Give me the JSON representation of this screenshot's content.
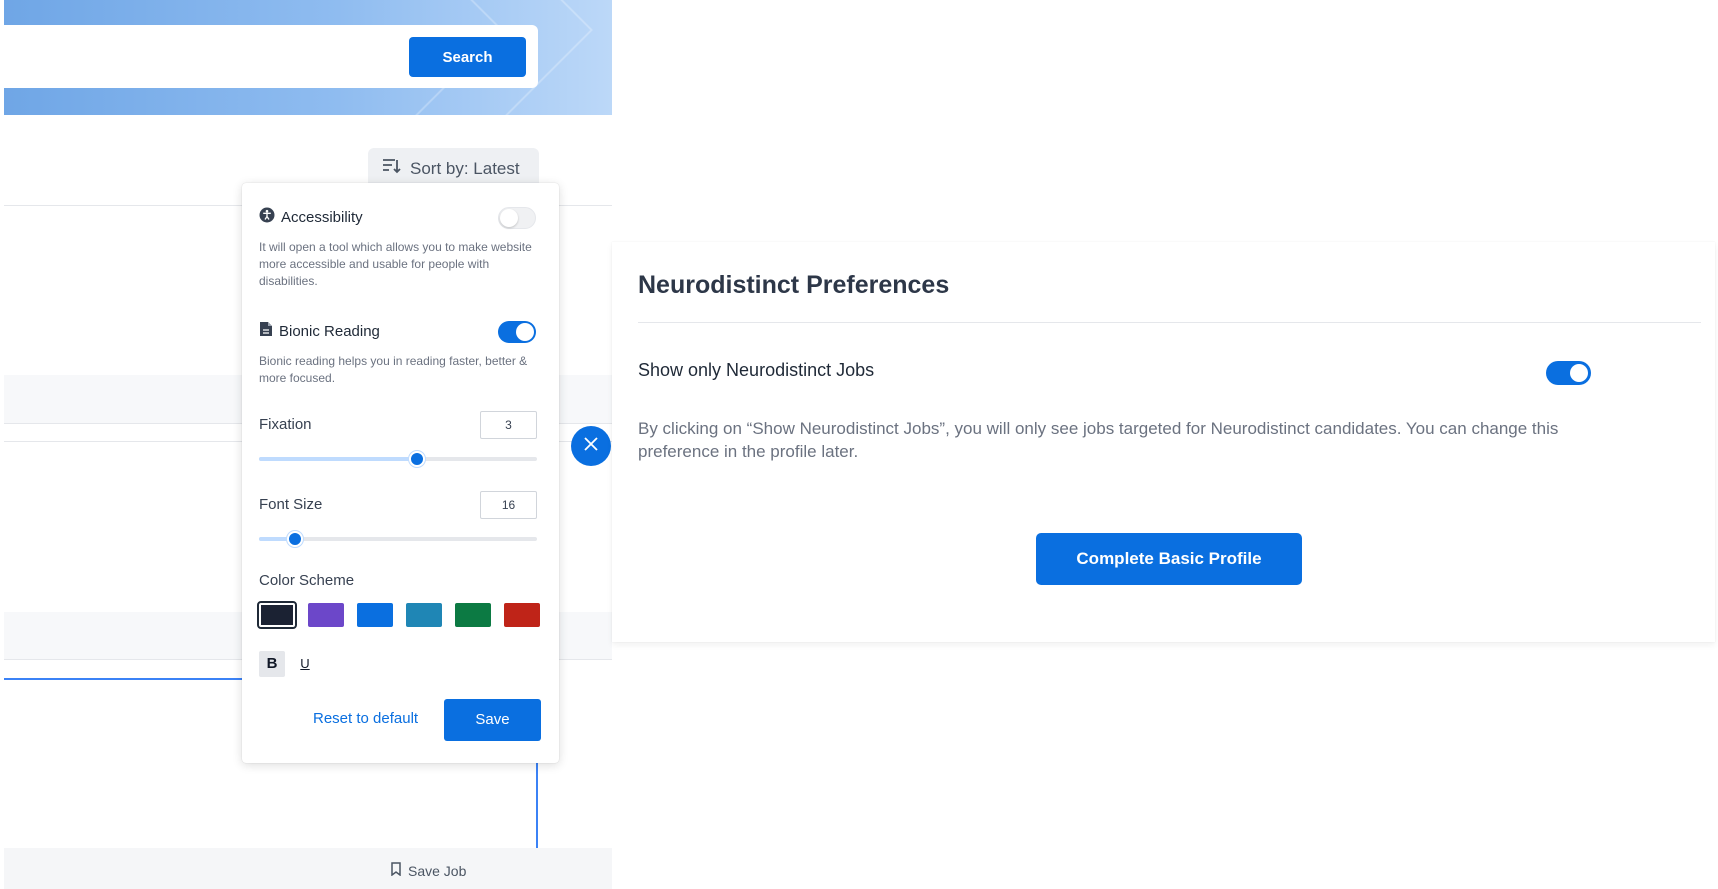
{
  "search": {
    "button_label": "Search"
  },
  "sort": {
    "label": "Sort by: Latest"
  },
  "accessibility_panel": {
    "accessibility": {
      "title": "Accessibility",
      "description": "It will open a tool which allows you to make website more accessible and usable for people with disabilities.",
      "enabled": false
    },
    "bionic_reading": {
      "title": "Bionic Reading",
      "description": "Bionic reading helps you in reading faster, better & more focused.",
      "enabled": true
    },
    "fixation": {
      "label": "Fixation",
      "value": "3",
      "slider_fraction": 0.57
    },
    "font_size": {
      "label": "Font Size",
      "value": "16",
      "slider_fraction": 0.13
    },
    "color_scheme": {
      "label": "Color Scheme",
      "colors": [
        "#1b2233",
        "#6c47c9",
        "#0a6fe0",
        "#1f86b5",
        "#0c7a43",
        "#bf2418"
      ],
      "selected_index": 0
    },
    "format_buttons": {
      "bold": "B",
      "underline": "U"
    },
    "reset_label": "Reset to default",
    "save_label": "Save"
  },
  "modal": {
    "title": "Neurodistinct Preferences",
    "toggle_label": "Show only Neurodistinct Jobs",
    "toggle_enabled": true,
    "description": "By clicking on “Show Neurodistinct Jobs”, you will only see jobs targeted for Neurodistinct candidates. You can change this preference in the profile later.",
    "primary_button": "Complete Basic Profile"
  },
  "job_card": {
    "save_job_label": "Save Job"
  },
  "icons": {
    "sort": "sort-icon",
    "accessibility": "accessibility-icon",
    "bionic": "document-icon",
    "close": "close-icon",
    "bookmark": "bookmark-icon"
  }
}
